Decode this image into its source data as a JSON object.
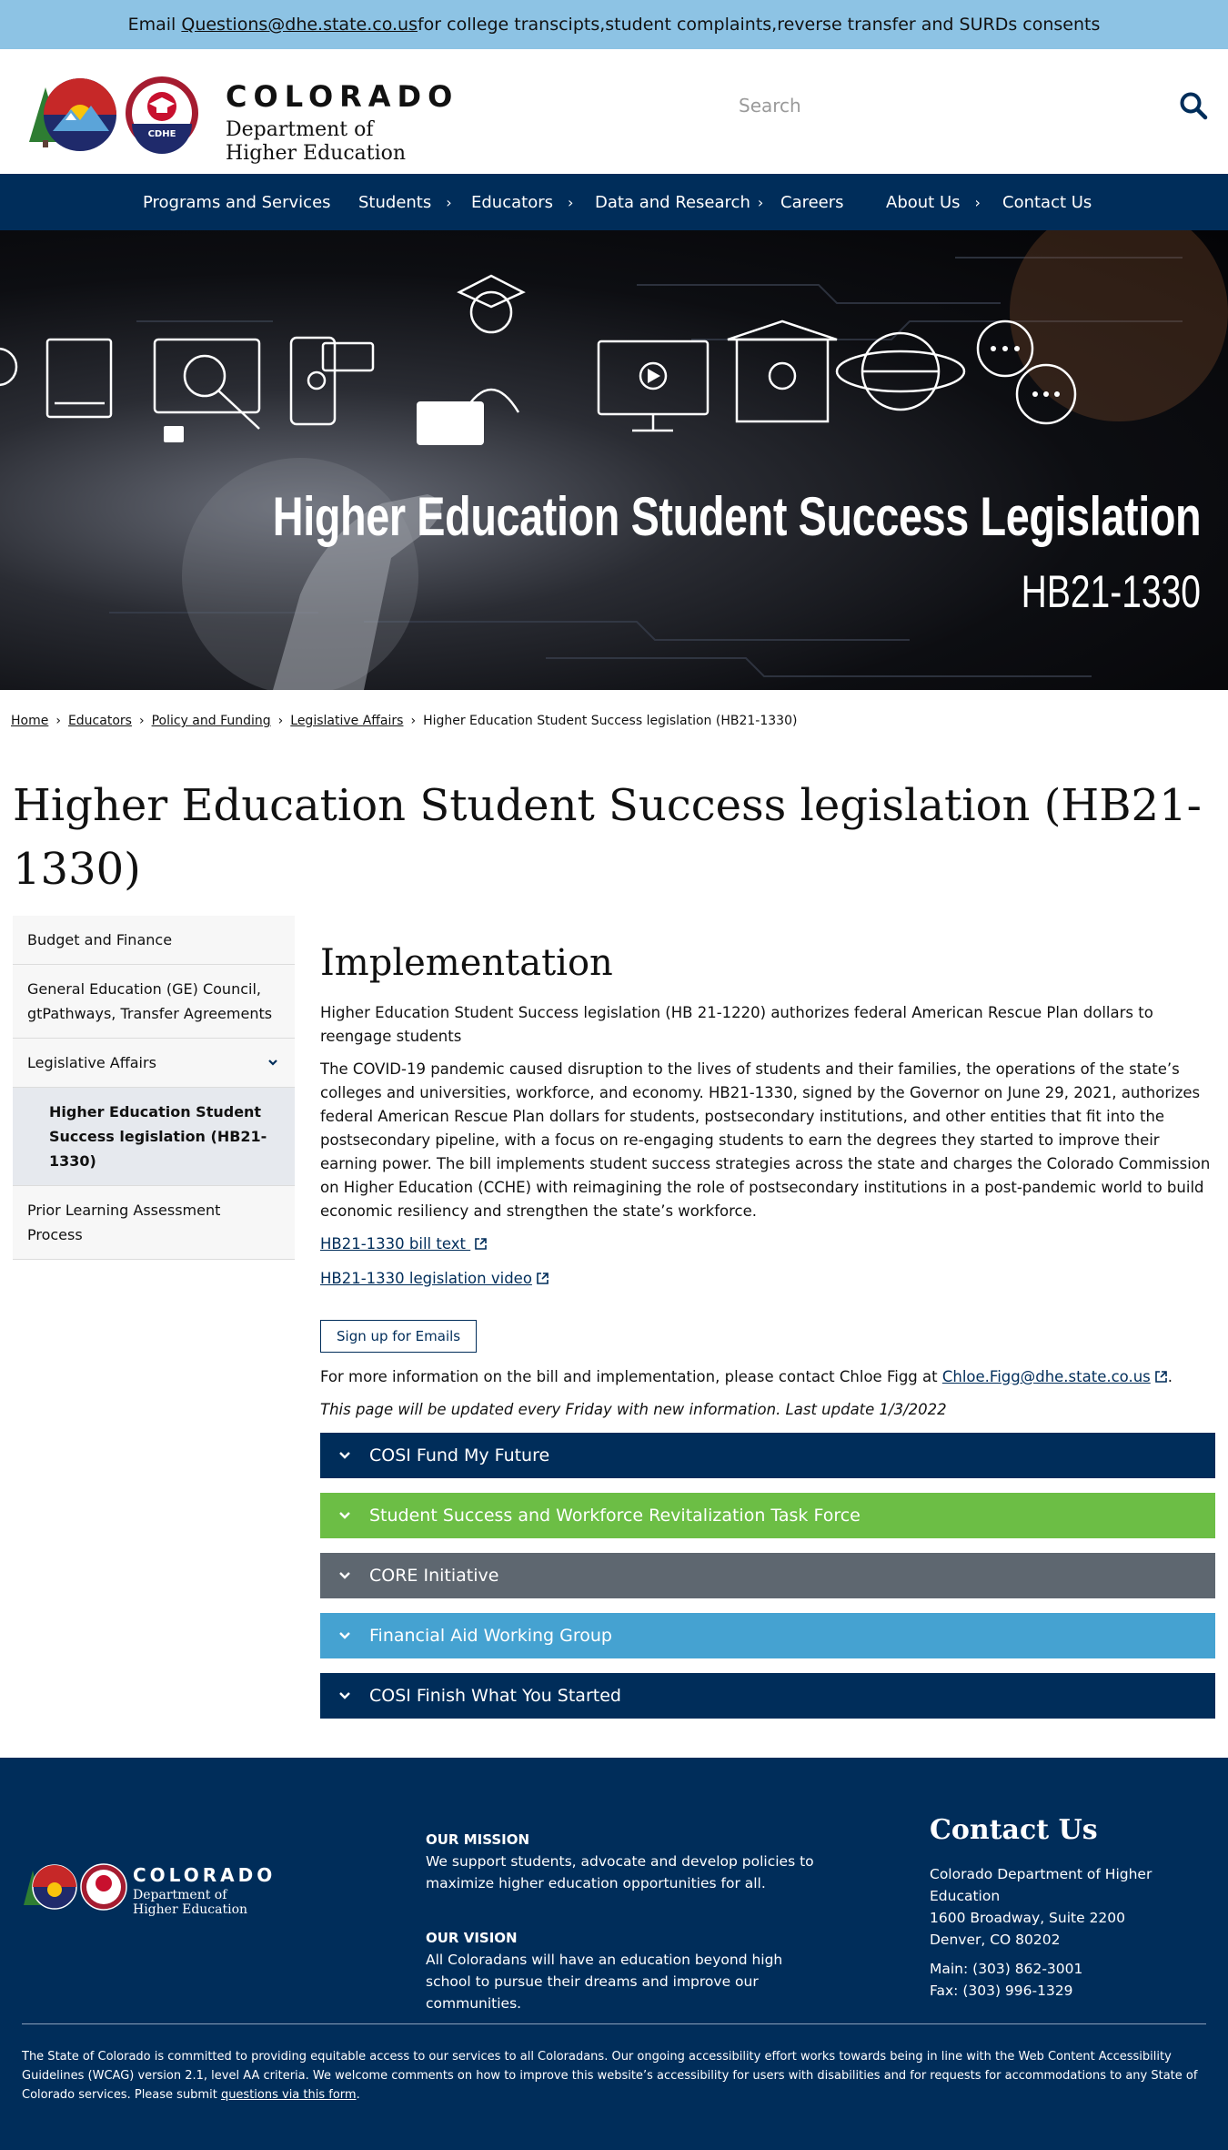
{
  "alert": {
    "prefix": "Email ",
    "email": "Questions@dhe.state.co.us",
    "suffix": " for college transcipts,student complaints,reverse transfer and SURDs consents"
  },
  "header": {
    "logo_colorado": "COLORADO",
    "logo_dept_line1": "Department of",
    "logo_dept_line2": "Higher Education",
    "logo_badge": "CDHE",
    "search_placeholder": "Search"
  },
  "nav": {
    "items": [
      {
        "label": "Programs and Services",
        "has_submenu": false
      },
      {
        "label": "Students",
        "has_submenu": true
      },
      {
        "label": "Educators",
        "has_submenu": true
      },
      {
        "label": "Data and Research",
        "has_submenu": true
      },
      {
        "label": "Careers",
        "has_submenu": false
      },
      {
        "label": "About Us",
        "has_submenu": true
      },
      {
        "label": "Contact Us",
        "has_submenu": false
      }
    ]
  },
  "hero": {
    "title": "Higher Education Student Success Legislation",
    "subtitle": "HB21-1330"
  },
  "breadcrumb": {
    "items": [
      "Home",
      "Educators",
      "Policy and Funding",
      "Legislative Affairs"
    ],
    "current": "Higher Education Student Success legislation (HB21-1330)",
    "separator": "›"
  },
  "page": {
    "title": "Higher Education Student Success legislation (HB21-1330)"
  },
  "sidebar": {
    "items": [
      {
        "label": "Budget and Finance"
      },
      {
        "label": "General Education (GE) Council, gtPathways, Transfer Agreements"
      },
      {
        "label": "Legislative Affairs"
      },
      {
        "label": "Higher Education Student Success legislation (HB21-1330)"
      },
      {
        "label": "Prior Learning Assessment Process"
      }
    ]
  },
  "main": {
    "heading": "Implementation",
    "intro": "Higher Education Student Success legislation (HB 21-1220) authorizes federal American Rescue Plan dollars to reengage students",
    "body": "The COVID-19 pandemic caused disruption to the lives of students and their families, the operations of the state’s colleges and universities, workforce, and economy. HB21-1330, signed by the Governor on June 29, 2021, authorizes federal American Rescue Plan dollars for students, postsecondary institutions, and other entities that fit into the postsecondary pipeline, with a focus on re-engaging students to earn the degrees they started to improve their earning power. The bill implements student success strategies across the state and charges the Colorado Commission on Higher Education (CCHE) with reimagining the role of postsecondary institutions in a post-pandemic world to build economic resiliency and strengthen the state’s workforce.",
    "link_bill": "HB21-1330 bill text ",
    "link_video": "HB21-1330 legislation video",
    "signup_label": "Sign up for Emails",
    "contact_prefix": "For more information on the bill and implementation, please contact Chloe Figg at ",
    "contact_email": "Chloe.Figg@dhe.state.co.us",
    "contact_suffix": ".",
    "update_note": "This page will be updated every Friday with new information. Last update 1/3/2022",
    "accordions": [
      {
        "label": "COSI Fund My Future",
        "color": "#002d5a"
      },
      {
        "label": "Student Success and Workforce Revitalization Task Force",
        "color": "#6cbe45"
      },
      {
        "label": "CORE Initiative",
        "color": "#5e6770"
      },
      {
        "label": "Financial Aid Working Group",
        "color": "#45a2d1"
      },
      {
        "label": "COSI Finish What You Started",
        "color": "#002d5a"
      }
    ]
  },
  "footer": {
    "logo_colorado": "COLORADO",
    "logo_dept_line1": "Department of",
    "logo_dept_line2": "Higher Education",
    "mission_heading": "OUR MISSION",
    "mission_text": "We support students, advocate and develop policies to maximize higher education opportunities for all.",
    "vision_heading": "OUR VISION",
    "vision_text": "All Coloradans will have an education beyond high school to pursue their dreams and improve our communities.",
    "contact_heading": "Contact Us",
    "org": "Colorado Department of Higher Education",
    "address1": "1600 Broadway, Suite 2200",
    "address2": "Denver, CO 80202",
    "main_phone": "Main: (303) 862-3001",
    "fax": "Fax: (303) 996-1329",
    "accessibility_text": "The State of Colorado is committed to providing equitable access to our services to all Coloradans. Our ongoing accessibility effort works towards being in line with the Web Content Accessibility Guidelines (WCAG) version 2.1, level AA criteria. We welcome comments on how to improve this website’s accessibility for users with disabilities and for requests for accommodations to any State of Colorado services. Please submit ",
    "accessibility_link": "questions via this form",
    "accessibility_end": "."
  },
  "colors": {
    "alert_bg": "#8dc3e4",
    "navy": "#002d5a",
    "green": "#6cbe45",
    "gray": "#5e6770",
    "lightblue": "#45a2d1"
  }
}
